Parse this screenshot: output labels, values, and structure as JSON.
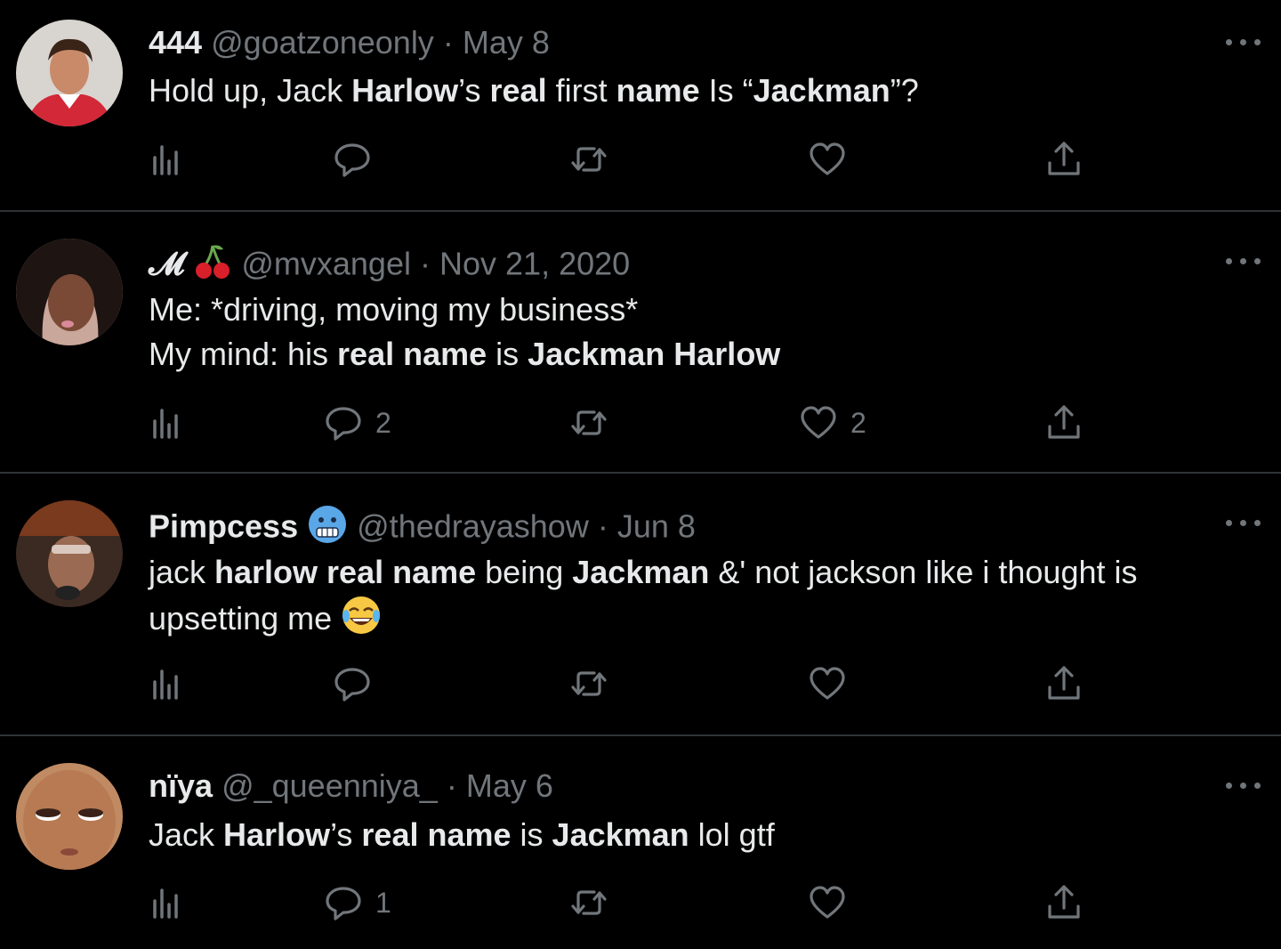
{
  "tweets": [
    {
      "name": "444",
      "handle": "@goatzoneonly",
      "separator": "·",
      "date": "May 8",
      "lines": [
        [
          {
            "t": "Hold up, Jack ",
            "b": false
          },
          {
            "t": "Harlow",
            "b": true
          },
          {
            "t": "’s ",
            "b": false
          },
          {
            "t": "real",
            "b": true
          },
          {
            "t": " first ",
            "b": false
          },
          {
            "t": "name",
            "b": true
          },
          {
            "t": " Is “",
            "b": false
          },
          {
            "t": "Jackman",
            "b": true
          },
          {
            "t": "”?",
            "b": false
          }
        ]
      ],
      "reply_count": "",
      "like_count": ""
    },
    {
      "name": "𝓜",
      "name_emoji": "cherry-emoji",
      "handle": "@mvxangel",
      "separator": "·",
      "date": "Nov 21, 2020",
      "lines": [
        [
          {
            "t": "Me: *driving, moving my business*",
            "b": false
          }
        ],
        [
          {
            "t": "My mind: his ",
            "b": false
          },
          {
            "t": "real name",
            "b": true
          },
          {
            "t": " is ",
            "b": false
          },
          {
            "t": "Jackman Harlow",
            "b": true
          }
        ]
      ],
      "reply_count": "2",
      "like_count": "2"
    },
    {
      "name": "Pimpcess",
      "name_emoji": "cold-face-emoji",
      "handle": "@thedrayashow",
      "separator": "·",
      "date": "Jun 8",
      "lines": [
        [
          {
            "t": "jack ",
            "b": false
          },
          {
            "t": "harlow real name",
            "b": true
          },
          {
            "t": " being ",
            "b": false
          },
          {
            "t": "Jackman",
            "b": true
          },
          {
            "t": " &' not jackson like i thought is",
            "b": false
          }
        ],
        [
          {
            "t": "upsetting me",
            "b": false
          }
        ]
      ],
      "trailing_emoji": "laughing-tears-emoji",
      "reply_count": "",
      "like_count": ""
    },
    {
      "name": "nïya",
      "handle": "@_queenniya_",
      "separator": "·",
      "date": "May 6",
      "lines": [
        [
          {
            "t": "Jack ",
            "b": false
          },
          {
            "t": "Harlow",
            "b": true
          },
          {
            "t": "’s ",
            "b": false
          },
          {
            "t": "real name",
            "b": true
          },
          {
            "t": " is ",
            "b": false
          },
          {
            "t": "Jackman",
            "b": true
          },
          {
            "t": " lol gtf",
            "b": false
          }
        ]
      ],
      "reply_count": "1",
      "like_count": ""
    }
  ],
  "colors": {
    "background": "#000000",
    "text": "#e7e9ea",
    "muted": "#71767b",
    "divider": "#2f3336"
  },
  "icons": [
    "views-icon",
    "reply-icon",
    "retweet-icon",
    "like-icon",
    "share-icon",
    "more-icon"
  ]
}
